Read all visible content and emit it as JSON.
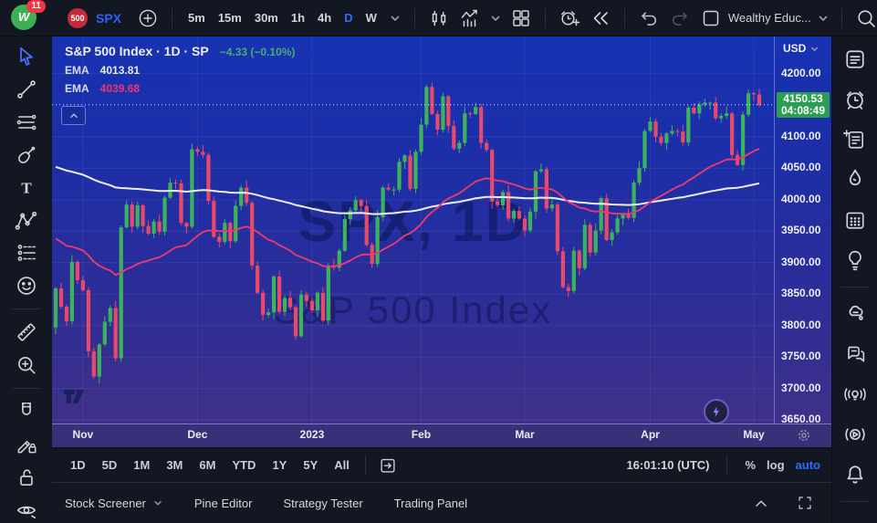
{
  "topbar": {
    "notification_count": "11",
    "symbol_badge": "500",
    "symbol": "SPX",
    "timeframes": [
      "5m",
      "15m",
      "30m",
      "1h",
      "4h",
      "D",
      "W"
    ],
    "active_timeframe": "D",
    "layout_name": "Wealthy Educ..."
  },
  "header": {
    "title": "S&P 500 Index · 1D · SP",
    "change": "−4.33 (−0.10%)",
    "indicators": [
      {
        "label": "EMA",
        "value": "4013.81"
      },
      {
        "label": "EMA",
        "value": "4039.68"
      }
    ]
  },
  "price_axis": {
    "currency": "USD",
    "last_price": "4150.53",
    "countdown": "04:08:49"
  },
  "watermark": {
    "line1": "SPX, 1D",
    "line2": "S&P 500 Index"
  },
  "range_toolbar": {
    "ranges": [
      "1D",
      "5D",
      "1M",
      "3M",
      "6M",
      "YTD",
      "1Y",
      "5Y",
      "All"
    ],
    "clock": "16:01:10 (UTC)",
    "percent_label": "%",
    "log_label": "log",
    "auto_label": "auto"
  },
  "panel_bar": {
    "items": [
      "Stock Screener",
      "Pine Editor",
      "Strategy Tester",
      "Trading Panel"
    ]
  },
  "chart_data": {
    "type": "candlestick",
    "symbol": "SPX",
    "interval": "1D",
    "title": "S&P 500 Index, 1D, SP",
    "ylim": [
      3643,
      4259
    ],
    "price_ticks": [
      4200,
      4100,
      4050,
      4000,
      3950,
      3900,
      3850,
      3800,
      3750,
      3700,
      3650
    ],
    "last_price": 4150.53,
    "up_color": "#3cb35a",
    "down_color": "#e9486b",
    "month_ticks": [
      {
        "label": "Nov",
        "i": 6
      },
      {
        "label": "Dec",
        "i": 27
      },
      {
        "label": "2023",
        "i": 48
      },
      {
        "label": "Feb",
        "i": 68
      },
      {
        "label": "Mar",
        "i": 87
      },
      {
        "label": "Apr",
        "i": 110
      },
      {
        "label": "May",
        "i": 129
      }
    ],
    "closes": [
      3797,
      3859,
      3830,
      3807,
      3901,
      3872,
      3856,
      3759,
      3719,
      3770,
      3806,
      3828,
      3748,
      3956,
      3992,
      3957,
      3991,
      3958,
      3946,
      3965,
      3949,
      4003,
      4027,
      4026,
      3963,
      3957,
      4080,
      4076,
      4071,
      3998,
      3941,
      3933,
      3963,
      3934,
      3990,
      4019,
      3995,
      3895,
      3852,
      3817,
      3821,
      3878,
      3822,
      3844,
      3829,
      3783,
      3849,
      3839,
      3824,
      3852,
      3808,
      3895,
      3892,
      3919,
      3969,
      3983,
      3999,
      3990,
      3928,
      3898,
      3972,
      4019,
      4016,
      4016,
      4060,
      4070,
      4017,
      4076,
      4119,
      4179,
      4136,
      4111,
      4164,
      4117,
      4081,
      4090,
      4137,
      4136,
      4147,
      4090,
      4079,
      3997,
      3991,
      4012,
      3970,
      3982,
      3970,
      3951,
      3981,
      4045,
      4048,
      3986,
      3992,
      3918,
      3861,
      3855,
      3919,
      3891,
      3960,
      3916,
      3951,
      4002,
      3936,
      3948,
      3970,
      3977,
      3971,
      4027,
      4050,
      4109,
      4124,
      4100,
      4090,
      4105,
      4109,
      4108,
      4091,
      4146,
      4137,
      4151,
      4154,
      4154,
      4129,
      4133,
      4137,
      4071,
      4055,
      4135,
      4169,
      4167,
      4150.53
    ],
    "emas": [
      {
        "label": "EMA",
        "value": "4013.81",
        "color": "#eceef6",
        "k": 0.013,
        "seed": 4058,
        "width": 2
      },
      {
        "label": "EMA",
        "value": "4039.68",
        "color": "#ef3a6e",
        "k": 0.05,
        "seed": 3950,
        "width": 1.8
      }
    ]
  }
}
